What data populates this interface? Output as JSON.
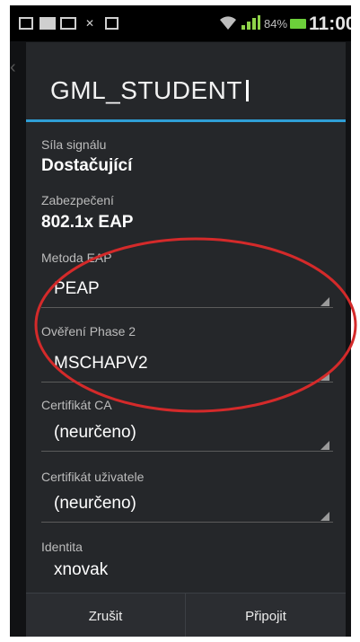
{
  "status_bar": {
    "battery": "84%",
    "time": "11:00",
    "icons": [
      "image-icon",
      "mail-icon",
      "mail-outline-icon",
      "missed-call-icon",
      "calendar-icon",
      "wifi-icon",
      "signal-icon",
      "battery-icon"
    ]
  },
  "dialog": {
    "title": "GML_STUDENT",
    "signal_label": "Síla signálu",
    "signal_value": "Dostačující",
    "security_label": "Zabezpečení",
    "security_value": "802.1x EAP",
    "eap_method_label": "Metoda EAP",
    "eap_method_value": "PEAP",
    "phase2_label": "Ověření Phase 2",
    "phase2_value": "MSCHAPV2",
    "ca_cert_label": "Certifikát CA",
    "ca_cert_value": "(neurčeno)",
    "user_cert_label": "Certifikát uživatele",
    "user_cert_value": "(neurčeno)",
    "identity_label": "Identita",
    "identity_value": "xnovak"
  },
  "buttons": {
    "cancel": "Zrušit",
    "connect": "Připojit"
  },
  "colors": {
    "accent": "#2f9fd6",
    "annotation": "#d42a2a",
    "battery": "#6ccf3a"
  }
}
